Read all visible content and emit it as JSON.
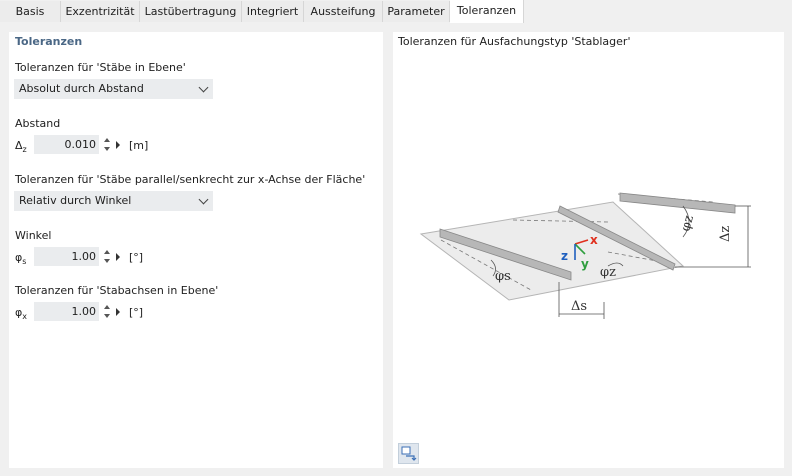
{
  "tabs": [
    {
      "label": "Basis",
      "active": false
    },
    {
      "label": "Exzentrizität",
      "active": false
    },
    {
      "label": "Lastübertragung",
      "active": false
    },
    {
      "label": "Integriert",
      "active": false
    },
    {
      "label": "Aussteifung",
      "active": false
    },
    {
      "label": "Parameter",
      "active": false
    },
    {
      "label": "Toleranzen",
      "active": true
    }
  ],
  "left": {
    "section_title": "Toleranzen",
    "group1_label": "Toleranzen für 'Stäbe in Ebene'",
    "group1_select": "Absolut durch Abstand",
    "abstand_label": "Abstand",
    "abstand_symbol": "Δ",
    "abstand_symbol_sub": "z",
    "abstand_value": "0.010",
    "abstand_unit": "[m]",
    "group2_label": "Toleranzen für 'Stäbe parallel/senkrecht zur x-Achse der Fläche'",
    "group2_select": "Relativ durch Winkel",
    "winkel_label": "Winkel",
    "winkel_symbol": "φ",
    "winkel_symbol_sub": "s",
    "winkel_value": "1.00",
    "winkel_unit": "[°]",
    "group3_label": "Toleranzen für 'Stabachsen in Ebene'",
    "phix_symbol": "φ",
    "phix_symbol_sub": "x",
    "phix_value": "1.00",
    "phix_unit": "[°]"
  },
  "right": {
    "title": "Toleranzen für Ausfachungstyp 'Stablager'",
    "diagram_labels": {
      "phi_z_top": "φz",
      "delta_z": "Δz",
      "phi_s": "φs",
      "phi_z_mid": "φz",
      "delta_s": "Δs",
      "axis_x": "x",
      "axis_y": "y",
      "axis_z": "z"
    }
  },
  "colors": {
    "accent_title": "#4a6785",
    "axis_x": "#e0301e",
    "axis_y": "#2e9e3e",
    "axis_z": "#1f5fbf"
  },
  "icons": [
    "chevron-down-icon",
    "spin-up-icon",
    "spin-down-icon",
    "arrow-right-icon",
    "view-options-icon"
  ]
}
